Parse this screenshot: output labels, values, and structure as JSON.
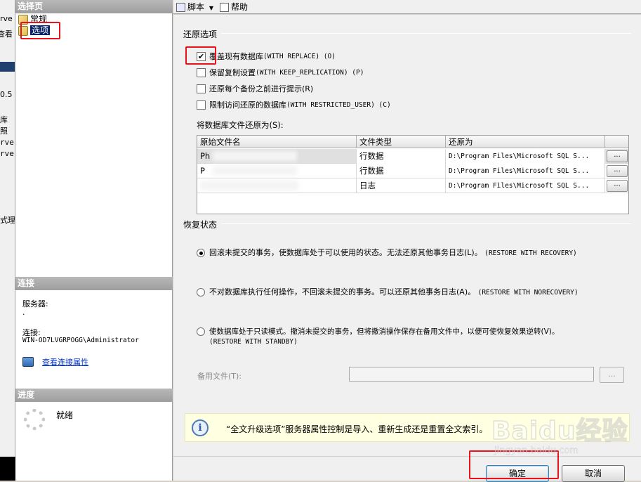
{
  "background_window": {
    "fragments": [
      "rve",
      "查看",
      "0.5",
      "库",
      "照",
      "rver",
      "rver",
      "式理"
    ]
  },
  "left_pane": {
    "select_page_header": "选择页",
    "pages": [
      {
        "label": "常规",
        "selected": false
      },
      {
        "label": "选项",
        "selected": true
      }
    ],
    "connection_header": "连接",
    "server_label": "服务器:",
    "server_value": ".",
    "connection_label": "连接:",
    "connection_value": "WIN-OD7LVGRPOGG\\Administrator",
    "view_properties_link": "查看连接属性",
    "progress_header": "进度",
    "progress_status": "就绪"
  },
  "toolbar": {
    "script_label": "脚本",
    "help_label": "帮助"
  },
  "restore_options": {
    "title": "还原选项",
    "checkboxes": [
      {
        "label": "覆盖现有数据库",
        "eng": "(WITH REPLACE) (O)",
        "checked": true
      },
      {
        "label": "保留复制设置",
        "eng": "(WITH KEEP_REPLICATION) (P)",
        "checked": false
      },
      {
        "label": "还原每个备份之前进行提示(R)",
        "eng": "",
        "checked": false
      },
      {
        "label": "限制访问还原的数据库",
        "eng": "(WITH RESTRICTED_USER) (C)",
        "checked": false
      }
    ]
  },
  "file_table": {
    "label": "将数据库文件还原为(S):",
    "columns": [
      "原始文件名",
      "文件类型",
      "还原为"
    ],
    "rows": [
      {
        "original": "Ph",
        "type": "行数据",
        "restore_as": "D:\\Program Files\\Microsoft SQL S..."
      },
      {
        "original": "P",
        "type": "行数据",
        "restore_as": "D:\\Program Files\\Microsoft SQL S..."
      },
      {
        "original": "",
        "type": "日志",
        "restore_as": "D:\\Program Files\\Microsoft SQL S..."
      }
    ],
    "browse_label": "..."
  },
  "recovery_state": {
    "title": "恢复状态",
    "options": [
      {
        "text": "回滚未提交的事务，使数据库处于可以使用的状态。无法还原其他事务日志(L)。",
        "eng": "(RESTORE WITH RECOVERY)",
        "eng2": "",
        "selected": true
      },
      {
        "text": "不对数据库执行任何操作，不回滚未提交的事务。可以还原其他事务日志(A)。",
        "eng": "(RESTORE WITH NORECOVERY)",
        "eng2": "",
        "selected": false
      },
      {
        "text": "使数据库处于只读模式。撤消未提交的事务，但将撤消操作保存在备用文件中，以便可使恢复效果逆转(V)。",
        "eng": "",
        "eng2": "(RESTORE WITH STANDBY)",
        "selected": false
      }
    ],
    "standby_label": "备用文件(T):",
    "standby_value": "",
    "standby_browse": "..."
  },
  "info": {
    "text": "“全文升级选项”服务器属性控制是导入、重新生成还是重置全文索引。"
  },
  "buttons": {
    "ok": "确定",
    "cancel": "取消"
  },
  "watermark": {
    "brand": "Baidu经验",
    "url": "jingyan.baidu.com"
  },
  "colors": {
    "highlight": "#e8131b",
    "selection": "#0a246a",
    "link": "#0033cc",
    "info_bg": "#ffffe1"
  }
}
